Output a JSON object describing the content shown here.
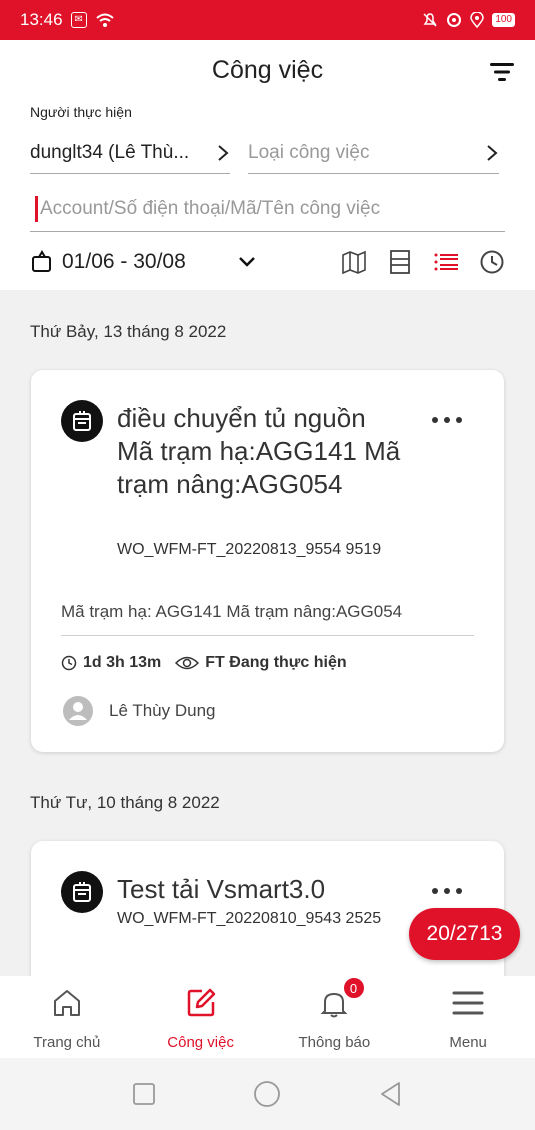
{
  "status_bar": {
    "time": "13:46",
    "battery": "100"
  },
  "header": {
    "title": "Công việc",
    "assignee_label": "Người thực hiện",
    "assignee_value": "dunglt34 (Lê Thù...",
    "job_type_placeholder": "Loại công việc",
    "search_placeholder": "Account/Số điện thoại/Mã/Tên công việc",
    "date_range": "01/06 - 30/08"
  },
  "groups": [
    {
      "date": "Thứ Bảy, 13 tháng 8 2022",
      "card": {
        "title": "điều chuyển tủ nguồn Mã trạm hạ:AGG141 Mã trạm nâng:AGG054",
        "code": "WO_WFM-FT_20220813_9554 9519",
        "description": "Mã trạm hạ: AGG141 Mã trạm nâng:AGG054",
        "duration": "1d 3h 13m",
        "status": "FT Đang thực hiện",
        "assignee": "Lê Thùy Dung"
      }
    },
    {
      "date": "Thứ Tư, 10 tháng 8 2022",
      "card": {
        "title": "Test tải Vsmart3.0",
        "code": "WO_WFM-FT_20220810_9543 2525"
      }
    }
  ],
  "counter": "20/2713",
  "bottom_nav": [
    {
      "label": "Trang chủ",
      "icon": "home-icon"
    },
    {
      "label": "Công việc",
      "icon": "edit-icon",
      "active": true
    },
    {
      "label": "Thông báo",
      "icon": "bell-icon",
      "badge": "0"
    },
    {
      "label": "Menu",
      "icon": "menu-icon"
    }
  ],
  "colors": {
    "accent": "#e0122a",
    "background": "#f1f1f1"
  }
}
